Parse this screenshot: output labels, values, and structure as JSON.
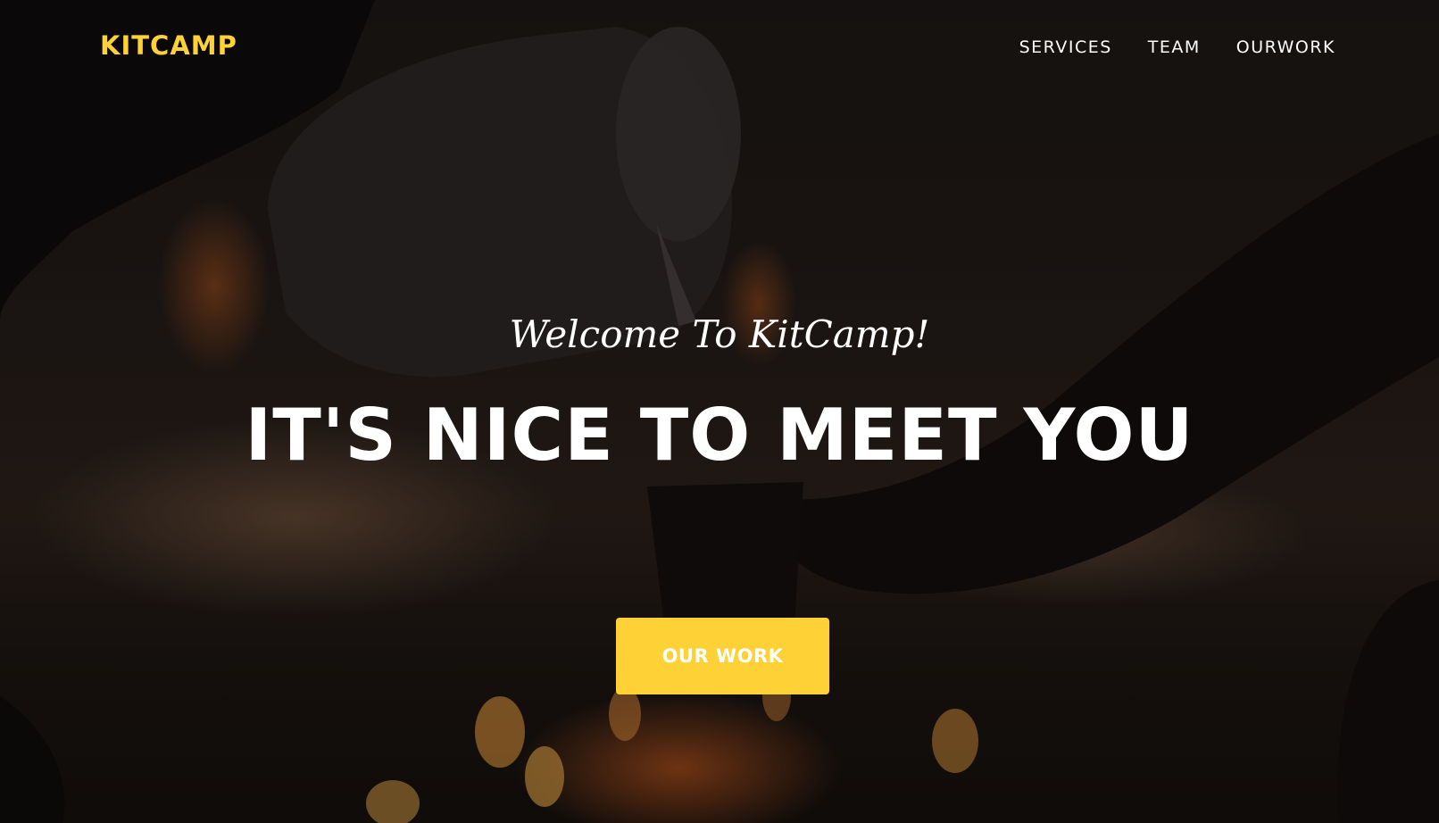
{
  "navbar": {
    "brand": "KITCAMP",
    "links": [
      {
        "label": "SERVICES"
      },
      {
        "label": "TEAM"
      },
      {
        "label": "OURWORK"
      }
    ]
  },
  "hero": {
    "subheading": "Welcome To KitCamp!",
    "heading": "IT'S NICE TO MEET YOU",
    "cta_label": "OUR WORK"
  },
  "colors": {
    "accent": "#fed136",
    "text": "#ffffff",
    "overlay": "#0b0908"
  }
}
